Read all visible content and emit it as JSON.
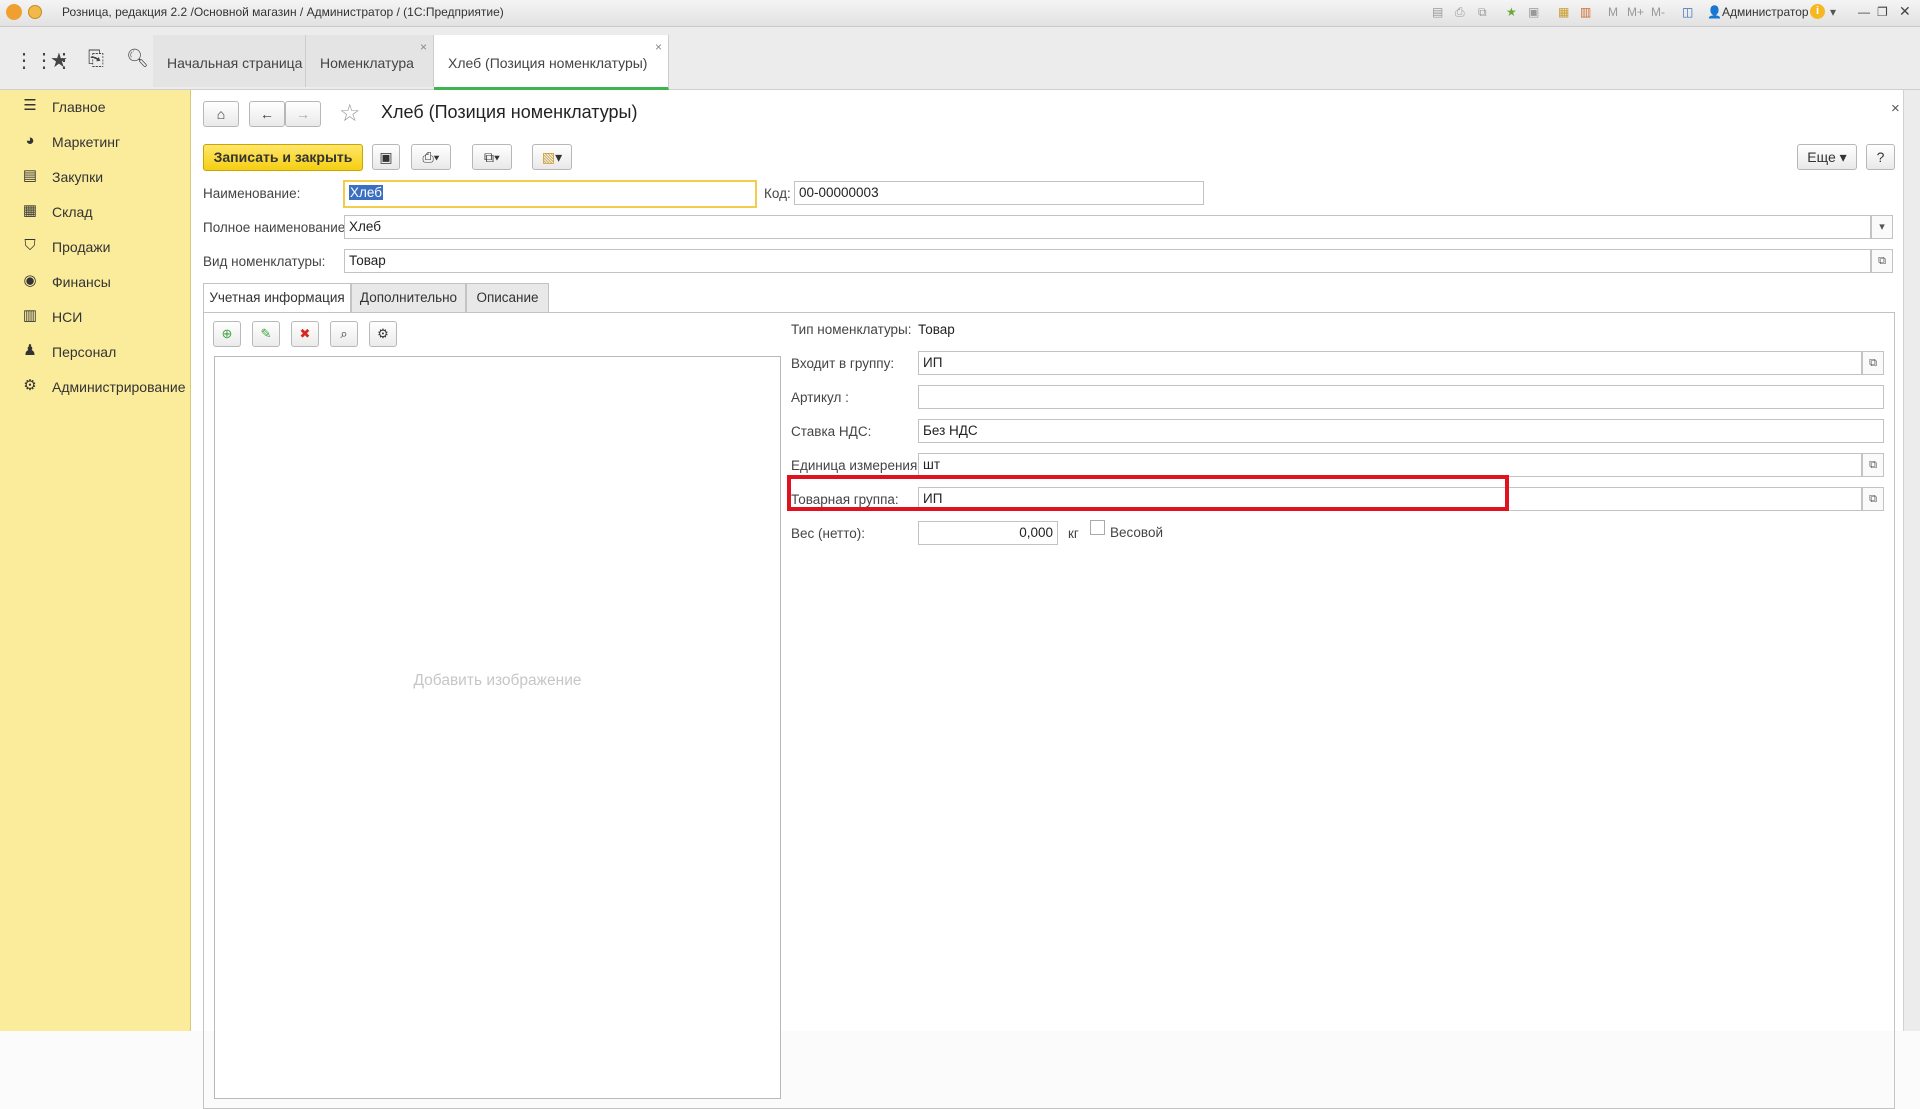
{
  "titlebar": {
    "title": "Розница, редакция 2.2 /Основной магазин / Администратор / (1С:Предприятие)",
    "user": "Администратор",
    "m_label": "M",
    "m_plus": "M+",
    "m_minus": "M-"
  },
  "tabs": [
    {
      "label": "Начальная страница"
    },
    {
      "label": "Номенклатура",
      "close": "×"
    },
    {
      "label": "Хлеб (Позиция номенклатуры)",
      "close": "×"
    }
  ],
  "sidebar": {
    "items": [
      {
        "label": "Главное"
      },
      {
        "label": "Маркетинг"
      },
      {
        "label": "Закупки"
      },
      {
        "label": "Склад"
      },
      {
        "label": "Продажи"
      },
      {
        "label": "Финансы"
      },
      {
        "label": "НСИ"
      },
      {
        "label": "Персонал"
      },
      {
        "label": "Администрирование"
      }
    ]
  },
  "form": {
    "title": "Хлеб (Позиция номенклатуры)",
    "close": "×",
    "save_close_label": "Записать и закрыть",
    "more_label": "Еще",
    "help_label": "?",
    "name_label": "Наименование:",
    "name_value": "Хлеб",
    "code_label": "Код:",
    "code_value": "00-00000003",
    "fullname_label": "Полное наименование:",
    "fullname_value": "Хлеб",
    "kind_label": "Вид номенклатуры:",
    "kind_value": "Товар",
    "panel_tabs": [
      "Учетная информация",
      "Дополнительно",
      "Описание"
    ],
    "image_placeholder": "Добавить изображение",
    "type_label": "Тип номенклатуры:",
    "type_value": "Товар",
    "group_label": "Входит в группу:",
    "group_value": "ИП",
    "article_label": "Артикул :",
    "article_value": "",
    "vat_label": "Ставка НДС:",
    "vat_value": "Без НДС",
    "unit_label": "Единица измерения:",
    "unit_value": "шт",
    "product_group_label": "Товарная группа:",
    "product_group_value": "ИП",
    "weight_label": "Вес (нетто):",
    "weight_value": "0,000",
    "weight_unit": "кг",
    "weighted_label": "Весовой"
  },
  "colors": {
    "sidebar_bg": "#fbec9c",
    "primary_button": "#f5cf12",
    "highlight_box": "#e0121f",
    "active_tab_underline": "#3fb34f"
  }
}
